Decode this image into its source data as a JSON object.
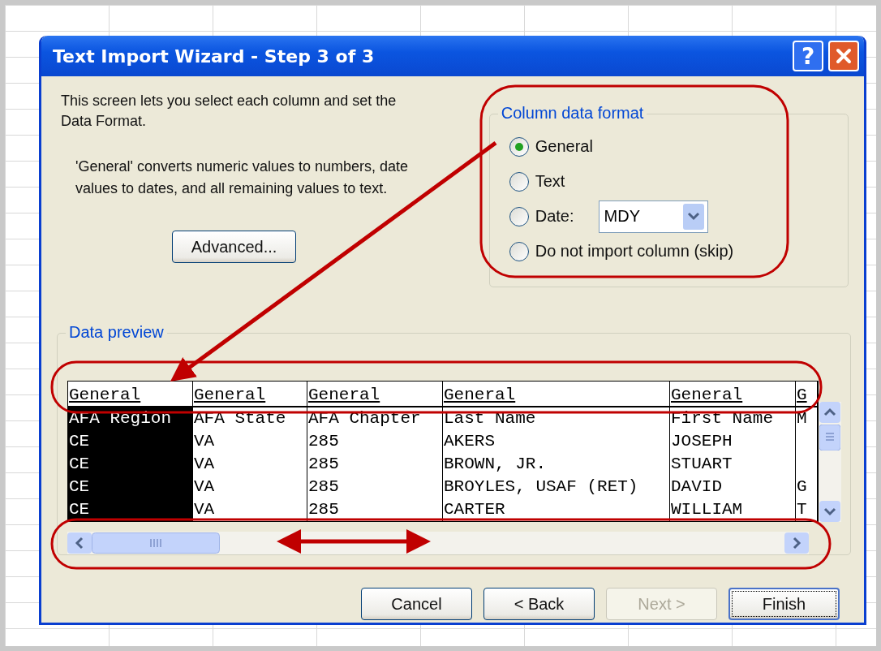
{
  "window": {
    "title": "Text Import Wizard - Step 3 of 3",
    "help_button": "?"
  },
  "intro": "This screen lets you select each column and set the Data Format.",
  "explanation": "'General' converts numeric values to numbers, date values to dates, and all remaining values to text.",
  "advanced_button": "Advanced...",
  "column_data_format": {
    "legend": "Column data format",
    "options": [
      {
        "label": "General",
        "selected": true
      },
      {
        "label": "Text",
        "selected": false
      },
      {
        "label": "Date:",
        "selected": false,
        "kind": "date"
      },
      {
        "label": "Do not import column (skip)",
        "selected": false
      }
    ],
    "date_format": "MDY"
  },
  "data_preview": {
    "legend": "Data preview",
    "columns": [
      {
        "header": "General",
        "selected": true
      },
      {
        "header": "General",
        "selected": false
      },
      {
        "header": "General",
        "selected": false
      },
      {
        "header": "General",
        "selected": false
      },
      {
        "header": "General",
        "selected": false
      },
      {
        "header": "G",
        "selected": false
      }
    ],
    "rows": [
      [
        "AFA Region",
        "AFA State",
        "AFA Chapter",
        "Last Name",
        "First Name",
        "M"
      ],
      [
        "CE",
        "VA",
        "285",
        "AKERS",
        "JOSEPH"
      ],
      [
        "CE",
        "VA",
        "285",
        "BROWN, JR.",
        "STUART"
      ],
      [
        "CE",
        "VA",
        "285",
        "BROYLES, USAF (RET)",
        "DAVID",
        "G"
      ],
      [
        "CE",
        "VA",
        "285",
        "CARTER",
        "WILLIAM",
        "T"
      ]
    ]
  },
  "buttons": [
    {
      "label": "Cancel",
      "disabled": false,
      "focused": false
    },
    {
      "label": "< Back",
      "disabled": false,
      "focused": false
    },
    {
      "label": "Next >",
      "disabled": true,
      "focused": false
    },
    {
      "label": "Finish",
      "disabled": false,
      "focused": true
    }
  ]
}
